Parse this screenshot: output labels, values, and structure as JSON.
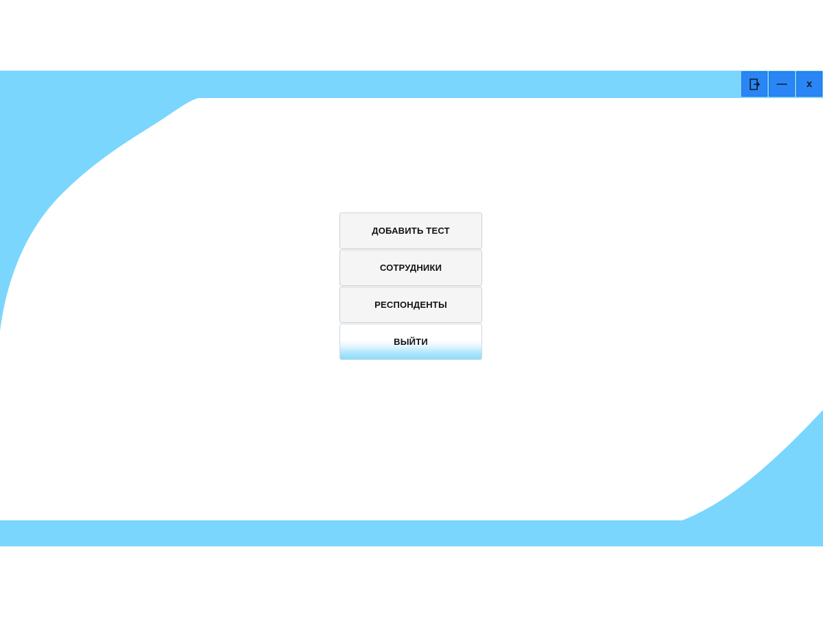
{
  "window": {
    "accent_color": "#7ad6fd",
    "controls": [
      {
        "name": "logout-icon",
        "label": ""
      },
      {
        "name": "minimize",
        "label": "—"
      },
      {
        "name": "close",
        "label": "x"
      }
    ]
  },
  "menu": {
    "add_test_label": "ДОБАВИТЬ ТЕСТ",
    "employees_label": "СОТРУДНИКИ",
    "respondents_label": "РЕСПОНДЕНТЫ",
    "exit_label": "ВЫЙТИ"
  }
}
